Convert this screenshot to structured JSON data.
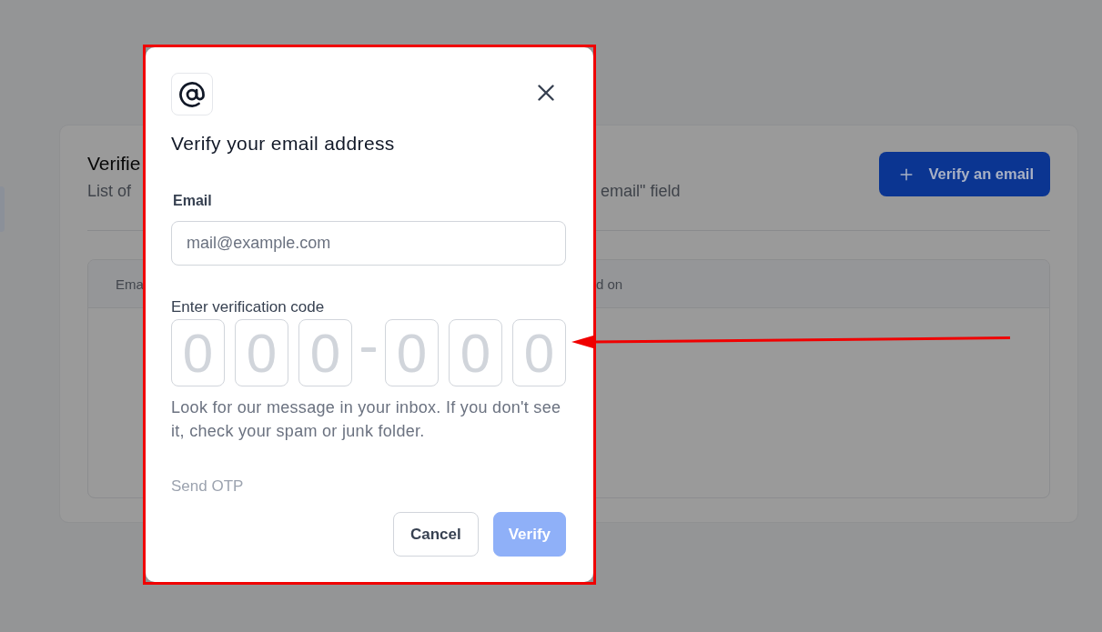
{
  "page": {
    "title": "Verifie",
    "subtitle_parts": [
      "List of",
      "email\" field"
    ],
    "add_button": {
      "label": "Verify an email"
    },
    "table": {
      "columns": [
        "Ema",
        "d on"
      ]
    }
  },
  "dialog": {
    "title": "Verify your email address",
    "email": {
      "label": "Email",
      "placeholder": "mail@example.com"
    },
    "code": {
      "label": "Enter verification code",
      "groups": [
        [
          {
            "placeholder": "0"
          },
          {
            "placeholder": "0"
          },
          {
            "placeholder": "0"
          }
        ],
        [
          {
            "placeholder": "0"
          },
          {
            "placeholder": "0"
          },
          {
            "placeholder": "0"
          }
        ]
      ]
    },
    "help": "Look for our message in your inbox. If you don't see it, check your spam or junk folder.",
    "send_otp": {
      "label": "Send OTP",
      "disabled": true
    },
    "buttons": [
      {
        "label": "Cancel",
        "kind": "secondary",
        "disabled": false
      },
      {
        "label": "Verify",
        "kind": "primary",
        "disabled": true
      }
    ]
  },
  "annotations": {
    "highlight_frame": true,
    "pointer_arrow": true
  }
}
